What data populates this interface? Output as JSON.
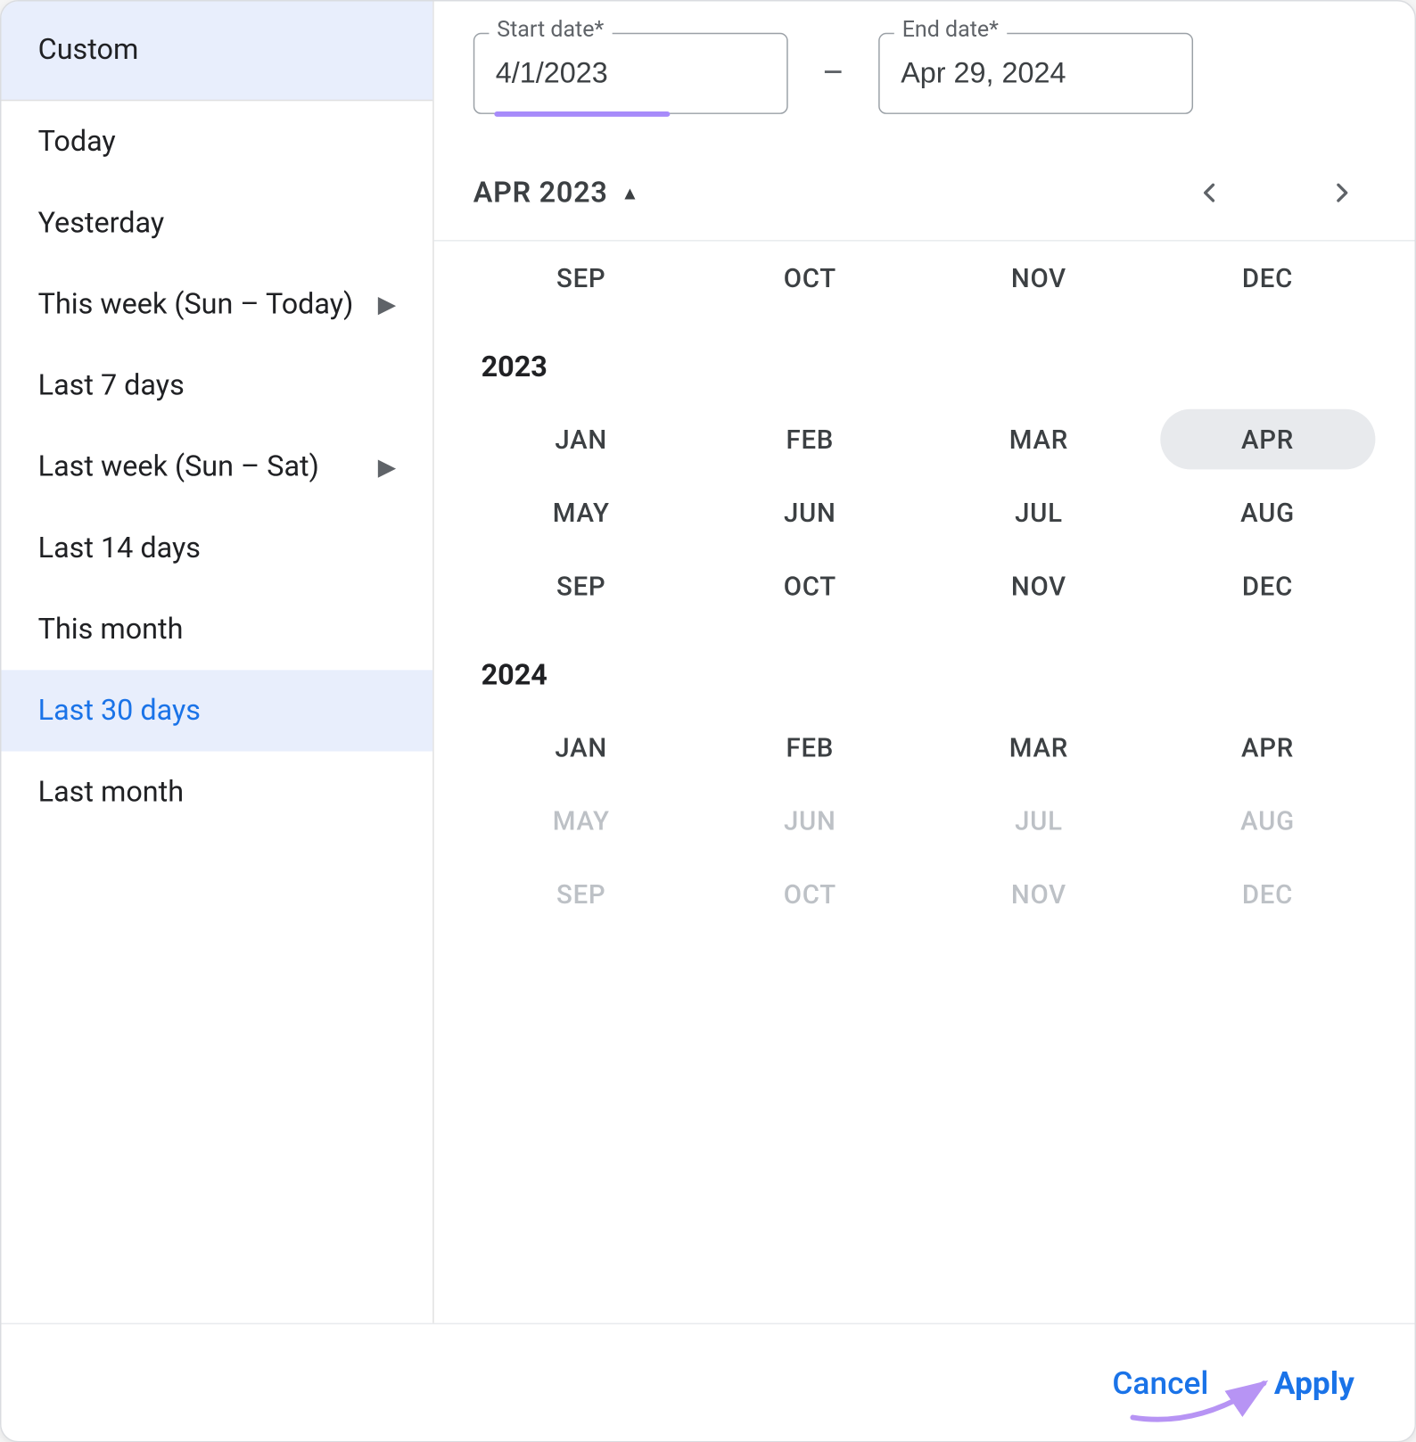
{
  "presets": {
    "custom": "Custom",
    "items": [
      {
        "label": "Today",
        "submenu": false,
        "active": false
      },
      {
        "label": "Yesterday",
        "submenu": false,
        "active": false
      },
      {
        "label": "This week (Sun – Today)",
        "submenu": true,
        "active": false
      },
      {
        "label": "Last 7 days",
        "submenu": false,
        "active": false
      },
      {
        "label": "Last week (Sun – Sat)",
        "submenu": true,
        "active": false
      },
      {
        "label": "Last 14 days",
        "submenu": false,
        "active": false
      },
      {
        "label": "This month",
        "submenu": false,
        "active": false
      },
      {
        "label": "Last 30 days",
        "submenu": false,
        "active": true
      },
      {
        "label": "Last month",
        "submenu": false,
        "active": false
      }
    ]
  },
  "inputs": {
    "start_label": "Start date*",
    "end_label": "End date*",
    "start_value": "4/1/2023",
    "end_value": "Apr 29, 2024",
    "separator": "–"
  },
  "calendar": {
    "header_month": "APR 2023",
    "selected_year": 2023,
    "selected_month": "APR",
    "tail_2022": [
      "SEP",
      "OCT",
      "NOV",
      "DEC"
    ],
    "months": [
      "JAN",
      "FEB",
      "MAR",
      "APR",
      "MAY",
      "JUN",
      "JUL",
      "AUG",
      "SEP",
      "OCT",
      "NOV",
      "DEC"
    ],
    "years": [
      {
        "year": "2023",
        "disabled_from": null
      },
      {
        "year": "2024",
        "disabled_from": 4
      }
    ]
  },
  "footer": {
    "cancel": "Cancel",
    "apply": "Apply"
  }
}
